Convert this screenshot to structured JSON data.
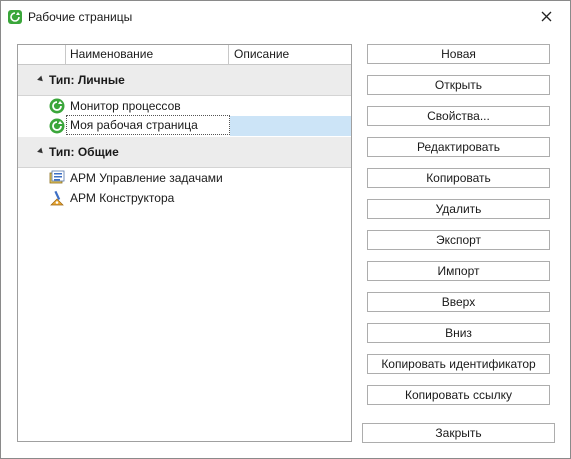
{
  "window": {
    "title": "Рабочие страницы"
  },
  "grid": {
    "columns": {
      "name": "Наименование",
      "description": "Описание"
    },
    "groups": [
      {
        "label": "Тип: Личные",
        "items": [
          {
            "name": "Монитор процессов",
            "description": "",
            "icon": "refresh-circle-icon"
          },
          {
            "name": "Моя рабочая страница",
            "description": "",
            "icon": "refresh-circle-icon",
            "selected": true
          }
        ]
      },
      {
        "label": "Тип: Общие",
        "items": [
          {
            "name": "АРМ Управление задачами",
            "description": "",
            "icon": "task-manager-icon"
          },
          {
            "name": "АРМ Конструктора",
            "description": "",
            "icon": "designer-icon"
          }
        ]
      }
    ]
  },
  "buttons": {
    "new": "Новая",
    "open": "Открыть",
    "properties": "Свойства...",
    "edit": "Редактировать",
    "copy": "Копировать",
    "delete": "Удалить",
    "export": "Экспорт",
    "import": "Импорт",
    "up": "Вверх",
    "down": "Вниз",
    "copy_id": "Копировать идентификатор",
    "copy_link": "Копировать ссылку",
    "close": "Закрыть"
  },
  "colors": {
    "accent_green": "#3aa63a",
    "selection": "#cce4f7",
    "group_bg": "#ececec"
  }
}
